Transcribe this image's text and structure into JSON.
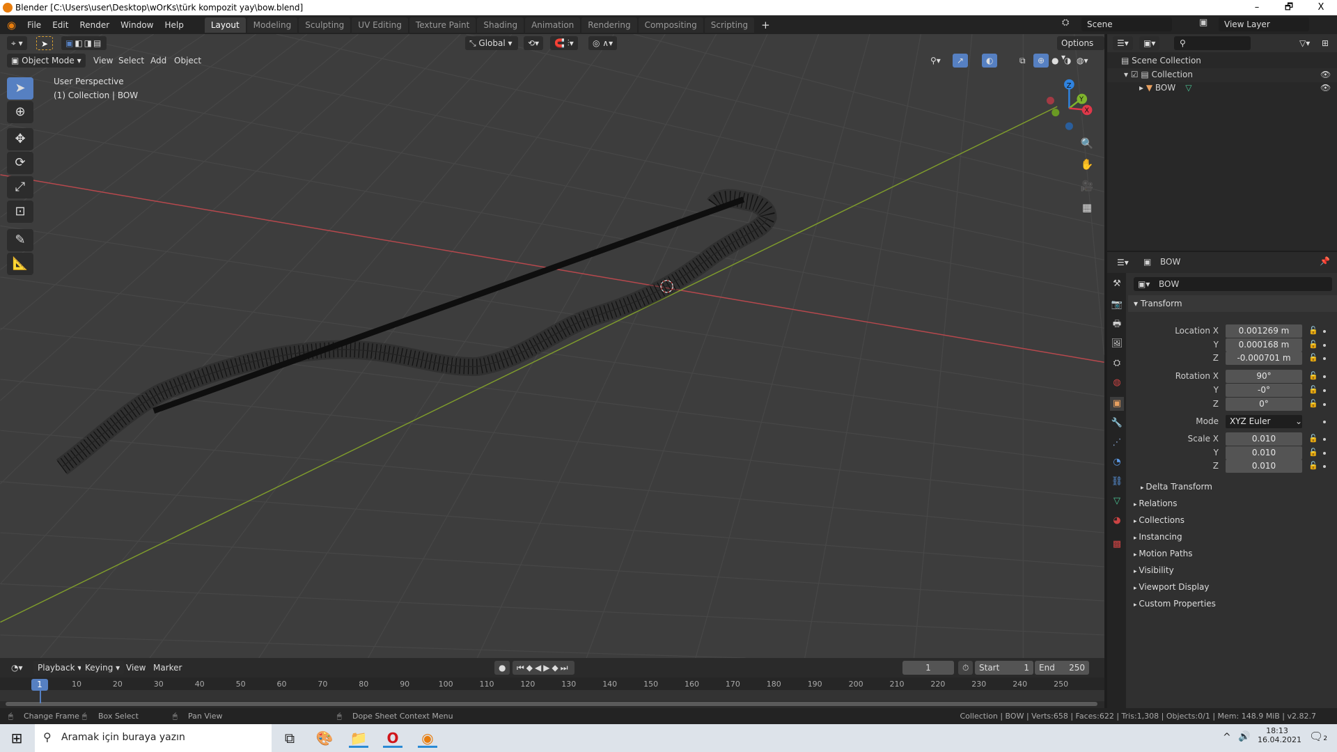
{
  "window": {
    "title": "Blender [C:\\Users\\user\\Desktop\\wOrKs\\türk kompozit yay\\bow.blend]",
    "minimize": "–",
    "restore": "🗗",
    "close": "X"
  },
  "menubar": {
    "items": [
      "File",
      "Edit",
      "Render",
      "Window",
      "Help"
    ],
    "workspaces": [
      "Layout",
      "Modeling",
      "Sculpting",
      "UV Editing",
      "Texture Paint",
      "Shading",
      "Animation",
      "Rendering",
      "Compositing",
      "Scripting"
    ],
    "add_workspace": "+",
    "active_workspace": "Layout",
    "scene": "Scene",
    "view_layer": "View Layer"
  },
  "viewport": {
    "transform_orientation": "Global",
    "options": "Options",
    "mode": "Object Mode",
    "menus": [
      "View",
      "Select",
      "Add",
      "Object"
    ],
    "overlay_title": "User Perspective",
    "overlay_subtitle": "(1) Collection | BOW",
    "gizmo": {
      "z": "Z",
      "y": "Y",
      "x": "X"
    },
    "colors": {
      "x_axis": "#b8484d",
      "y_axis": "#7f9c2c",
      "background": "#3d3d3d",
      "active_tool": "#5680c2"
    }
  },
  "outliner": {
    "scene_collection": "Scene Collection",
    "collection": "Collection",
    "object": "BOW"
  },
  "properties": {
    "object_name": "BOW",
    "name_field": "BOW",
    "transform": "Transform",
    "rows": [
      {
        "label": "Location X",
        "value": "0.001269 m"
      },
      {
        "label": "Y",
        "value": "0.000168 m"
      },
      {
        "label": "Z",
        "value": "-0.000701 m"
      },
      {
        "label": "Rotation X",
        "value": "90°"
      },
      {
        "label": "Y",
        "value": "-0°"
      },
      {
        "label": "Z",
        "value": "0°"
      },
      {
        "label": "Mode",
        "value": "XYZ Euler"
      },
      {
        "label": "Scale X",
        "value": "0.010"
      },
      {
        "label": "Y",
        "value": "0.010"
      },
      {
        "label": "Z",
        "value": "0.010"
      }
    ],
    "sections": [
      "Delta Transform",
      "Relations",
      "Collections",
      "Instancing",
      "Motion Paths",
      "Visibility",
      "Viewport Display",
      "Custom Properties"
    ]
  },
  "timeline": {
    "menus": [
      "Playback",
      "Keying",
      "View",
      "Marker"
    ],
    "current_frame": "1",
    "start_label": "Start",
    "start": "1",
    "end_label": "End",
    "end": "250",
    "ticks": [
      "10",
      "20",
      "30",
      "40",
      "50",
      "60",
      "70",
      "80",
      "90",
      "100",
      "110",
      "120",
      "130",
      "140",
      "150",
      "160",
      "170",
      "180",
      "190",
      "200",
      "210",
      "220",
      "230",
      "240",
      "250"
    ]
  },
  "statusbar": {
    "hints": [
      "Change Frame",
      "Box Select",
      "Pan View",
      "Dope Sheet Context Menu"
    ],
    "info": "Collection | BOW | Verts:658 | Faces:622 | Tris:1,308 | Objects:0/1 | Mem: 148.9 MiB | v2.82.7"
  },
  "taskbar": {
    "search_placeholder": "Aramak için buraya yazın",
    "time": "18:13",
    "date": "16.04.2021",
    "notifications": "2"
  }
}
